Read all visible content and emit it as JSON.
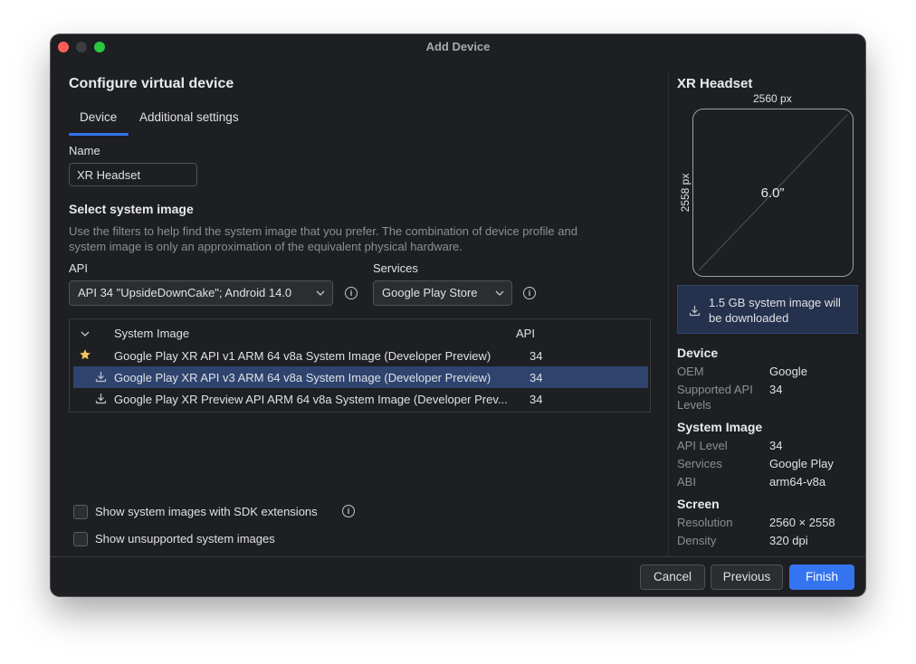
{
  "window": {
    "title": "Add Device"
  },
  "left": {
    "heading": "Configure virtual device",
    "tabs": [
      {
        "label": "Device"
      },
      {
        "label": "Additional settings"
      }
    ],
    "name_label": "Name",
    "name_value": "XR Headset",
    "system_image_heading": "Select system image",
    "description_line1": "Use the filters to help find the system image that you prefer. The combination of device profile and",
    "description_line2": "system image is only an approximation of the equivalent physical hardware.",
    "api_label": "API",
    "api_value": "API 34 \"UpsideDownCake\"; Android 14.0",
    "services_label": "Services",
    "services_value": "Google Play Store",
    "table": {
      "headers": {
        "system_image": "System Image",
        "api": "API"
      },
      "rows": [
        {
          "name": "Google Play XR API v1 ARM 64 v8a System Image (Developer Preview)",
          "api": "34",
          "icon": "star-icon"
        },
        {
          "name": "Google Play XR API v3 ARM 64 v8a System Image (Developer Preview)",
          "api": "34",
          "icon": "download-icon"
        },
        {
          "name": "Google Play XR Preview API ARM 64 v8a System Image (Developer Prev...",
          "api": "34",
          "icon": "download-icon"
        }
      ]
    },
    "checkbox_sdk": "Show system images with SDK extensions",
    "checkbox_unsupported": "Show unsupported system images"
  },
  "right": {
    "title": "XR Headset",
    "width_label": "2560 px",
    "height_label": "2558 px",
    "diagonal": "6.0”",
    "banner_line1": "1.5 GB system image will",
    "banner_line2": "be downloaded",
    "device_section": "Device",
    "oem_key": "OEM",
    "oem_value": "Google",
    "supported_key_line1": "Supported API",
    "supported_key_line2": "Levels",
    "supported_value": "34",
    "system_image_section": "System Image",
    "api_level_key": "API Level",
    "api_level_value": "34",
    "services_key": "Services",
    "services_value": "Google Play",
    "abi_key": "ABI",
    "abi_value": "arm64-v8a",
    "screen_section": "Screen",
    "resolution_key": "Resolution",
    "resolution_value": "2560 × 2558",
    "density_key": "Density",
    "density_value": "320 dpi"
  },
  "footer": {
    "cancel": "Cancel",
    "previous": "Previous",
    "finish": "Finish"
  },
  "colors": {
    "accent": "#3574f0",
    "selection": "#2e436e",
    "star": "#f2c55c",
    "background": "#1e1f22"
  }
}
